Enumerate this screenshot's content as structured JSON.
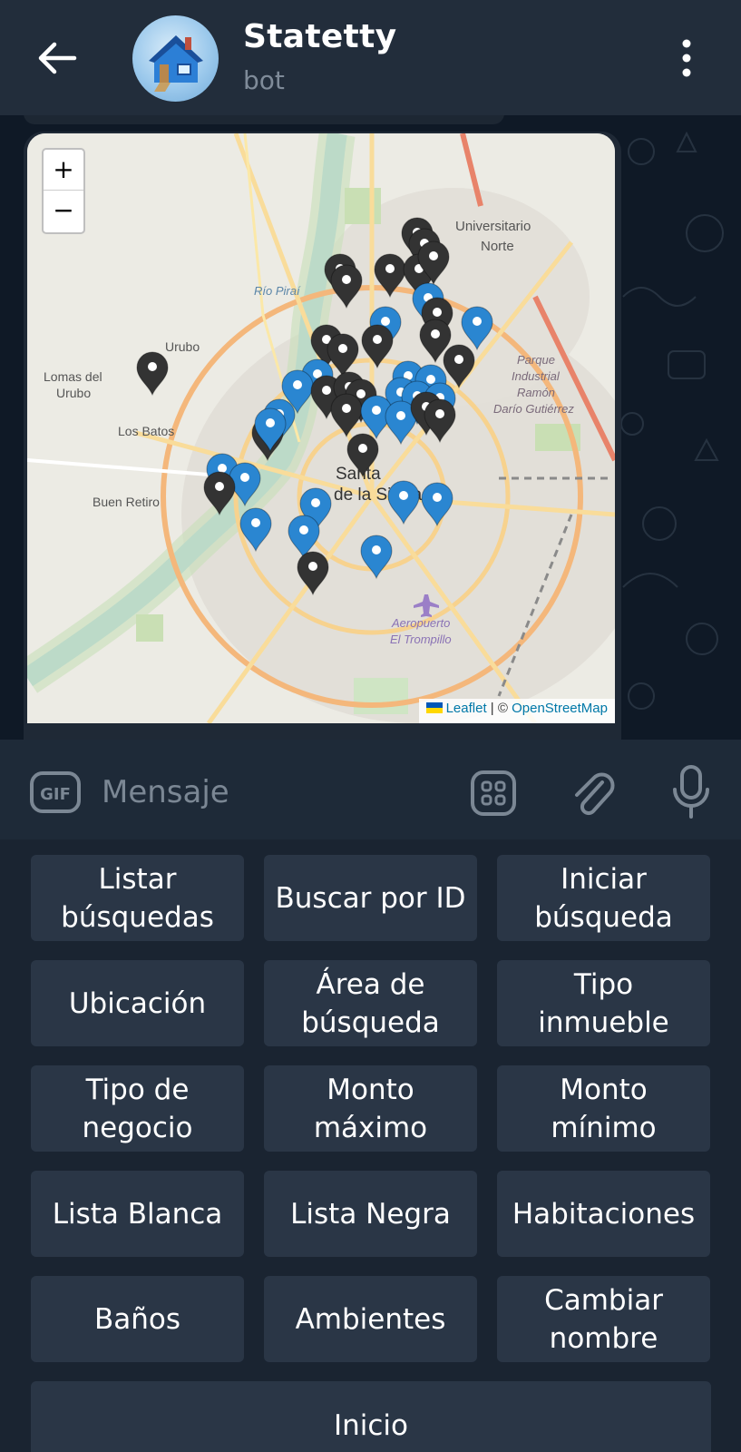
{
  "header": {
    "title": "Statetty",
    "subtitle": "bot"
  },
  "map": {
    "zoom_in": "+",
    "zoom_out": "−",
    "labels": {
      "universitario": "Universitario",
      "norte": "Norte",
      "rio": "Río Piraí",
      "urubo": "Urubo",
      "lomas1": "Lomas del",
      "lomas2": "Urubo",
      "batos": "Los Batos",
      "retiro": "Buen Retiro",
      "santa": "Santa",
      "sierra": "de la Sierra",
      "parque1": "Parque",
      "parque2": "Industrial",
      "parque3": "Ramón",
      "parque4": "Darío Gutiérrez",
      "aero1": "Aeropuerto",
      "aero2": "El Trompillo"
    },
    "attribution": {
      "leaflet": "Leaflet",
      "sep": " | © ",
      "osm": "OpenStreetMap"
    }
  },
  "composer": {
    "gif_label": "GIF",
    "placeholder": "Mensaje"
  },
  "keyboard": {
    "buttons": [
      "Listar\nbúsquedas",
      "Buscar por ID",
      "Iniciar\nbúsqueda",
      "Ubicación",
      "Área de\nbúsqueda",
      "Tipo\ninmueble",
      "Tipo de\nnegocio",
      "Monto\nmáximo",
      "Monto\nmínimo",
      "Lista Blanca",
      "Lista Negra",
      "Habitaciones",
      "Baños",
      "Ambientes",
      "Cambiar\nnombre",
      "Inicio"
    ]
  },
  "colors": {
    "header_bg": "#222d3b",
    "chat_bg": "#0f1926",
    "keyboard_bg": "#1a2431",
    "key_bg": "#2a3646",
    "marker_blue": "#2a86d1",
    "marker_black": "#333333"
  }
}
